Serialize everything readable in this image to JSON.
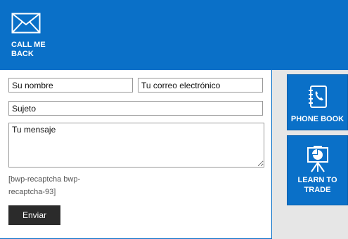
{
  "callback": {
    "icon": "envelope-icon",
    "label": "CALL ME BACK"
  },
  "form": {
    "name_placeholder": "Su nombre",
    "email_placeholder": "Tu correo electrónico",
    "subject_placeholder": "Sujeto",
    "message_placeholder": "Tu mensaje",
    "captcha_text": "[bwp-recaptcha bwp-recaptcha-93]",
    "submit_label": "Enviar"
  },
  "tiles": [
    {
      "icon": "phone-book-icon",
      "label": "PHONE BOOK"
    },
    {
      "icon": "presentation-chart-icon",
      "label": "LEARN TO TRADE"
    }
  ],
  "colors": {
    "brand_blue": "#0a70c8",
    "button_dark": "#2b2b2b",
    "side_gray": "#e6e6e6"
  }
}
